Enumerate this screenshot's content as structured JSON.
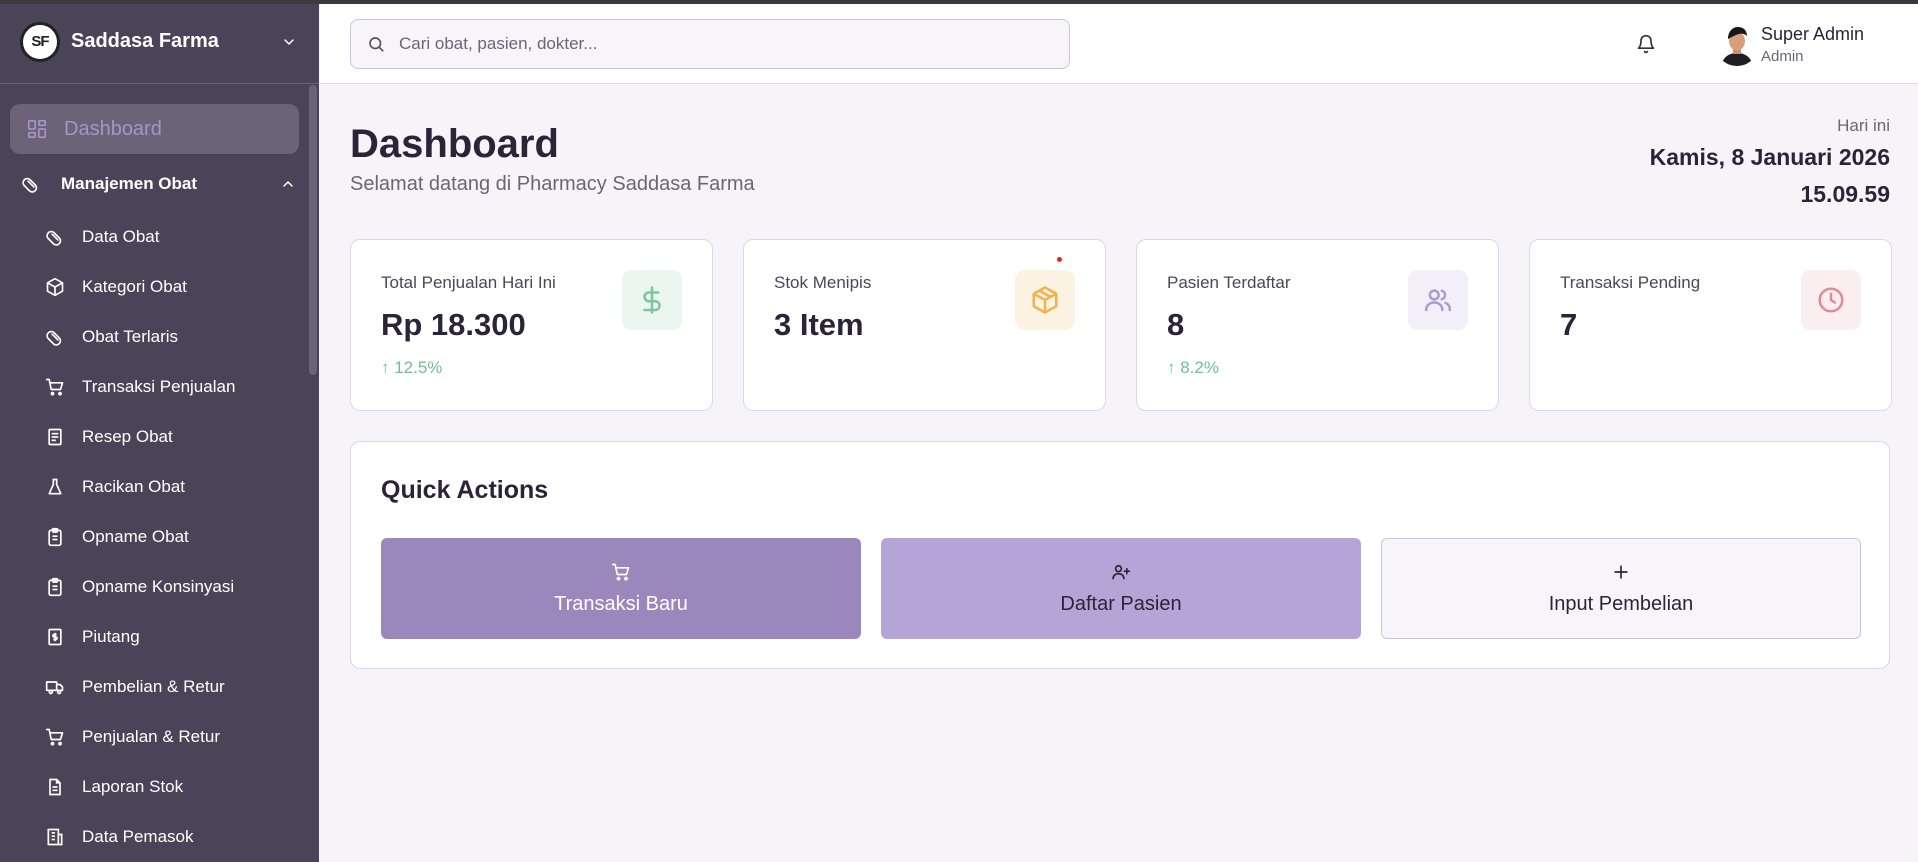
{
  "brand": {
    "name": "Saddasa Farma",
    "logo_text": "SF"
  },
  "sidebar": {
    "active": {
      "label": "Dashboard",
      "icon": "dashboard-grid-icon"
    },
    "group": {
      "label": "Manajemen Obat",
      "icon": "pill-icon",
      "expanded": true
    },
    "items": [
      {
        "label": "Data Obat",
        "icon": "pill-icon"
      },
      {
        "label": "Kategori Obat",
        "icon": "box-icon"
      },
      {
        "label": "Obat Terlaris",
        "icon": "pill-icon"
      },
      {
        "label": "Transaksi Penjualan",
        "icon": "cart-icon"
      },
      {
        "label": "Resep Obat",
        "icon": "document-icon"
      },
      {
        "label": "Racikan Obat",
        "icon": "flask-icon"
      },
      {
        "label": "Opname Obat",
        "icon": "clipboard-icon"
      },
      {
        "label": "Opname Konsinyasi",
        "icon": "clipboard-icon"
      },
      {
        "label": "Piutang",
        "icon": "receipt-dollar-icon"
      },
      {
        "label": "Pembelian & Retur",
        "icon": "truck-icon"
      },
      {
        "label": "Penjualan & Retur",
        "icon": "cart-icon"
      },
      {
        "label": "Laporan Stok",
        "icon": "report-icon"
      },
      {
        "label": "Data Pemasok",
        "icon": "building-icon"
      }
    ]
  },
  "header": {
    "search_placeholder": "Cari obat, pasien, dokter...",
    "user_name": "Super Admin",
    "user_role": "Admin"
  },
  "page": {
    "title": "Dashboard",
    "subtitle": "Selamat datang di Pharmacy Saddasa Farma",
    "today_label": "Hari ini",
    "date": "Kamis, 8 Januari 2026",
    "time": "15.09.59"
  },
  "stats": [
    {
      "label": "Total Penjualan Hari Ini",
      "value": "Rp 18.300",
      "trend": "↑ 12.5%",
      "icon": "dollar-icon"
    },
    {
      "label": "Stok Menipis",
      "value": "3 Item",
      "trend": "",
      "icon": "package-icon"
    },
    {
      "label": "Pasien Terdaftar",
      "value": "8",
      "trend": "↑ 8.2%",
      "icon": "users-icon"
    },
    {
      "label": "Transaksi Pending",
      "value": "7",
      "trend": "",
      "icon": "clock-icon"
    }
  ],
  "quick_actions": {
    "title": "Quick Actions",
    "buttons": [
      {
        "label": "Transaksi Baru",
        "icon": "cart-icon"
      },
      {
        "label": "Daftar Pasien",
        "icon": "user-plus-icon"
      },
      {
        "label": "Input Pembelian",
        "icon": "plus-icon"
      }
    ]
  },
  "colors": {
    "sidebar_bg": "#4a4458",
    "accent": "#9c87bd",
    "accent_light": "#b5a5d6",
    "trend_green": "#6fbf94"
  }
}
